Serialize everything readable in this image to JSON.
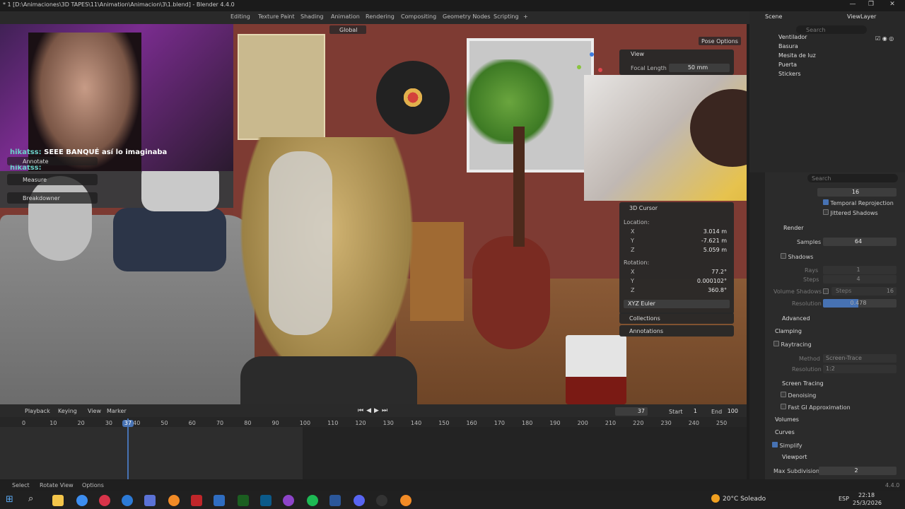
{
  "window": {
    "title": "* 1 [D:\\Animaciones\\3D TAPES\\11\\Animation\\Animacion\\3\\1.blend] - Blender 4.4.0"
  },
  "workspace_tabs": [
    "Editing",
    "Texture Paint",
    "Shading",
    "Animation",
    "Rendering",
    "Compositing",
    "Geometry Nodes",
    "Scripting",
    "+"
  ],
  "viewport_header": {
    "orientation": "Global",
    "pose_options": "Pose Options"
  },
  "scene": {
    "label": "Scene",
    "view_layer": "ViewLayer"
  },
  "outliner": {
    "search_placeholder": "Search",
    "items": [
      "Ventilador",
      "Basura",
      "Mesita de luz",
      "Puerta",
      "Stickers"
    ]
  },
  "chat": {
    "messages": [
      {
        "user": "hikatss:",
        "text": "SEEE BANQUÉ así lo imaginaba"
      },
      {
        "user": "hikatss:",
        "text": ""
      }
    ]
  },
  "tools": [
    "Annotate",
    "Measure",
    "Breakdowner"
  ],
  "n_panel": {
    "view_header": "View",
    "focal_length_label": "Focal Length",
    "focal_length_value": "50 mm",
    "cursor_header": "3D Cursor",
    "location_label": "Location:",
    "location": [
      {
        "axis": "X",
        "value": "3.014 m"
      },
      {
        "axis": "Y",
        "value": "-7.621 m"
      },
      {
        "axis": "Z",
        "value": "5.059 m"
      }
    ],
    "rotation_label": "Rotation:",
    "rotation": [
      {
        "axis": "X",
        "value": "77.2°"
      },
      {
        "axis": "Y",
        "value": "0.000102°"
      },
      {
        "axis": "Z",
        "value": "360.8°"
      }
    ],
    "rotation_mode": "XYZ Euler",
    "collections": "Collections",
    "annotations": "Annotations"
  },
  "properties": {
    "search_placeholder": "Search",
    "samples_top": "16",
    "temporal_reprojection": "Temporal Reprojection",
    "jittered_shadows": "Jittered Shadows",
    "render_header": "Render",
    "samples_label": "Samples",
    "samples_value": "64",
    "shadows_label": "Shadows",
    "rays_label": "Rays",
    "rays_value": "1",
    "steps_label": "Steps",
    "steps_value": "4",
    "volume_shadows_label": "Volume Shadows",
    "volume_steps_label": "Steps",
    "volume_steps_value": "16",
    "resolution_label": "Resolution",
    "resolution_value": "0.478",
    "advanced": "Advanced",
    "clamping": "Clamping",
    "raytracing": "Raytracing",
    "method_label": "Method",
    "method_value": "Screen-Trace",
    "rt_resolution_label": "Resolution",
    "rt_resolution_value": "1:2",
    "screen_tracing": "Screen Tracing",
    "denoising": "Denoising",
    "fast_gi": "Fast GI Approximation",
    "volumes": "Volumes",
    "curves": "Curves",
    "simplify": "Simplify",
    "viewport": "Viewport",
    "max_subdivision_label": "Max Subdivision",
    "max_subdivision_value": "2"
  },
  "timeline": {
    "menus": [
      "Playback",
      "Keying",
      "View",
      "Marker"
    ],
    "current_frame": "37",
    "start_label": "Start",
    "start": "1",
    "end_label": "End",
    "end": "100",
    "ticks": [
      "0",
      "10",
      "20",
      "30",
      "40",
      "50",
      "60",
      "70",
      "80",
      "90",
      "100",
      "110",
      "120",
      "130",
      "140",
      "150",
      "160",
      "170",
      "180",
      "190",
      "200",
      "210",
      "220",
      "230",
      "240",
      "250"
    ],
    "playhead_label": "37"
  },
  "statusbar": {
    "select": "Select",
    "rotate_view": "Rotate View",
    "options": "Options",
    "version": "4.4.0"
  },
  "taskbar": {
    "weather": "20°C  Soleado",
    "lang": "ESP",
    "time": "22:18",
    "date": "25/3/2026"
  }
}
